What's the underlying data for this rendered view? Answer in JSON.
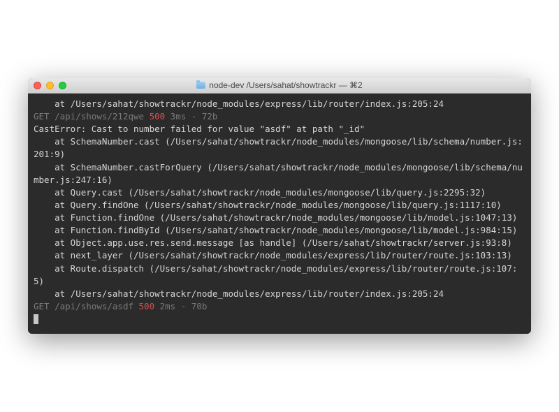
{
  "window": {
    "title": "node-dev  /Users/sahat/showtrackr — ⌘2"
  },
  "terminal": {
    "lines": [
      {
        "indent": "    ",
        "text": "at /Users/sahat/showtrackr/node_modules/express/lib/router/index.js:205:24"
      },
      {
        "type": "request",
        "method": "GET",
        "path": "/api/shows/212qwe",
        "status": "500",
        "time": "3ms",
        "size": "72b"
      },
      {
        "text": "CastError: Cast to number failed for value \"asdf\" at path \"_id\""
      },
      {
        "indent": "    ",
        "text": "at SchemaNumber.cast (/Users/sahat/showtrackr/node_modules/mongoose/lib/schema/number.js:201:9)"
      },
      {
        "indent": "    ",
        "text": "at SchemaNumber.castForQuery (/Users/sahat/showtrackr/node_modules/mongoose/lib/schema/number.js:247:16)"
      },
      {
        "indent": "    ",
        "text": "at Query.cast (/Users/sahat/showtrackr/node_modules/mongoose/lib/query.js:2295:32)"
      },
      {
        "indent": "    ",
        "text": "at Query.findOne (/Users/sahat/showtrackr/node_modules/mongoose/lib/query.js:1117:10)"
      },
      {
        "indent": "    ",
        "text": "at Function.findOne (/Users/sahat/showtrackr/node_modules/mongoose/lib/model.js:1047:13)"
      },
      {
        "indent": "    ",
        "text": "at Function.findById (/Users/sahat/showtrackr/node_modules/mongoose/lib/model.js:984:15)"
      },
      {
        "indent": "    ",
        "text": "at Object.app.use.res.send.message [as handle] (/Users/sahat/showtrackr/server.js:93:8)"
      },
      {
        "indent": "    ",
        "text": "at next_layer (/Users/sahat/showtrackr/node_modules/express/lib/router/route.js:103:13)"
      },
      {
        "indent": "    ",
        "text": "at Route.dispatch (/Users/sahat/showtrackr/node_modules/express/lib/router/route.js:107:5)"
      },
      {
        "indent": "    ",
        "text": "at /Users/sahat/showtrackr/node_modules/express/lib/router/index.js:205:24"
      },
      {
        "type": "request",
        "method": "GET",
        "path": "/api/shows/asdf",
        "status": "500",
        "time": "2ms",
        "size": "70b"
      }
    ]
  }
}
